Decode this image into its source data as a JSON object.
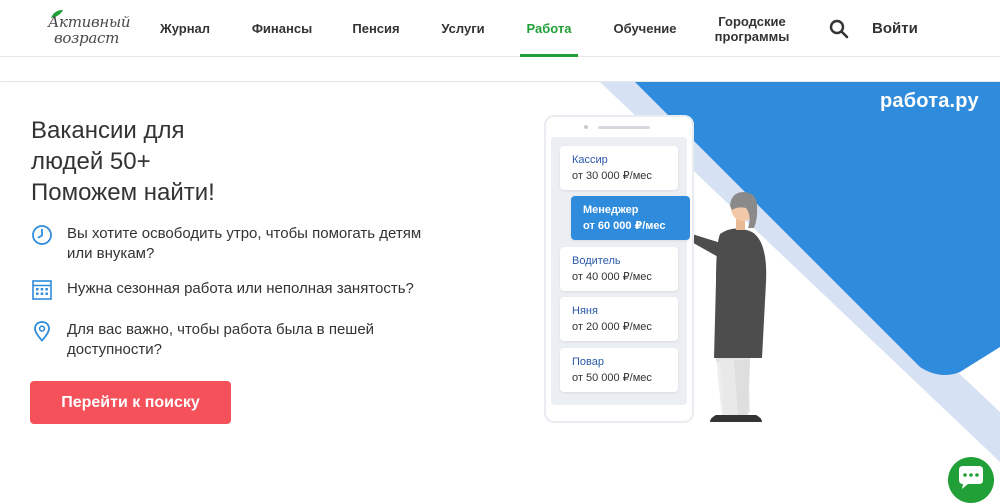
{
  "logo": {
    "line1": "Активный",
    "line2": "возраст"
  },
  "nav": {
    "items": [
      {
        "label": "Журнал"
      },
      {
        "label": "Финансы"
      },
      {
        "label": "Пенсия"
      },
      {
        "label": "Услуги"
      },
      {
        "label": "Работа",
        "active": true
      },
      {
        "label": "Обучение"
      },
      {
        "label": "Городские программы"
      }
    ],
    "login": "Войти"
  },
  "hero": {
    "title_lines": [
      "Вакансии для",
      "людей 50+",
      "Поможем найти!"
    ],
    "features": [
      {
        "icon": "clock-icon",
        "text": "Вы хотите освободить утро, чтобы помогать детям или внукам?"
      },
      {
        "icon": "calendar-icon",
        "text": "Нужна сезонная работа или неполная занятость?"
      },
      {
        "icon": "location-pin-icon",
        "text": "Для вас важно, чтобы работа была в пешей доступности?"
      }
    ],
    "cta": "Перейти к поиску"
  },
  "illustration": {
    "brand": "работа.ру",
    "jobs": [
      {
        "title": "Кассир",
        "salary": "от 30 000 ₽/мес"
      },
      {
        "title": "Менеджер",
        "salary": "от 60 000 ₽/мес",
        "highlighted": true
      },
      {
        "title": "Водитель",
        "salary": "от 40 000 ₽/мес"
      },
      {
        "title": "Няня",
        "salary": "от 20 000 ₽/мес"
      },
      {
        "title": "Повар",
        "salary": "от 50 000 ₽/мес"
      }
    ]
  },
  "chat": {
    "label": "чат"
  },
  "colors": {
    "accent_green": "#21a038",
    "cta_red": "#f4515b",
    "brand_blue": "#2f8bdb"
  }
}
